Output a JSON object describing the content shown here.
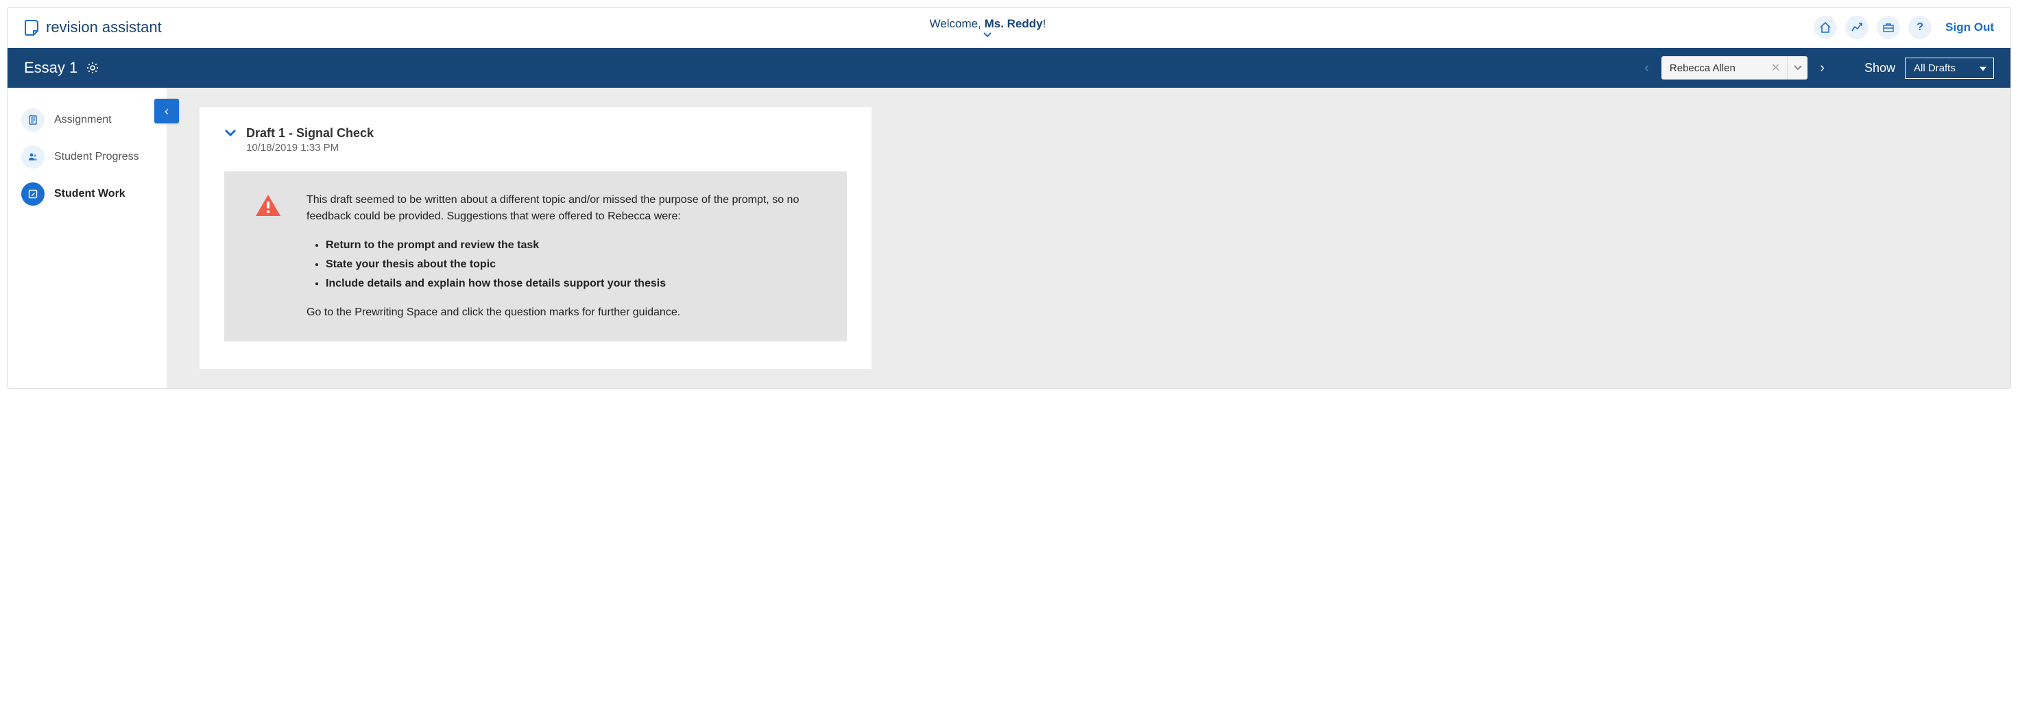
{
  "header": {
    "logo_text": "revision assistant",
    "welcome_prefix": "Welcome, ",
    "welcome_name": "Ms. Reddy",
    "welcome_suffix": "!",
    "sign_out": "Sign Out",
    "help_symbol": "?"
  },
  "subheader": {
    "essay_title": "Essay 1",
    "show_label": "Show",
    "student_name": "Rebecca Allen",
    "drafts_filter": "All Drafts"
  },
  "sidebar": {
    "items": [
      {
        "label": "Assignment",
        "id": "assignment"
      },
      {
        "label": "Student Progress",
        "id": "student-progress"
      },
      {
        "label": "Student Work",
        "id": "student-work"
      }
    ]
  },
  "draft": {
    "title": "Draft 1 - Signal Check",
    "timestamp": "10/18/2019 1:33 PM",
    "feedback_intro": "This draft seemed to be written about a different topic and/or missed the purpose of the prompt, so no feedback could be provided. Suggestions that were offered to Rebecca were:",
    "suggestions": [
      "Return to the prompt and review the task",
      "State your thesis about the topic",
      "Include details and explain how those details support your thesis"
    ],
    "feedback_outro": "Go to the Prewriting Space and click the question marks for further guidance."
  }
}
